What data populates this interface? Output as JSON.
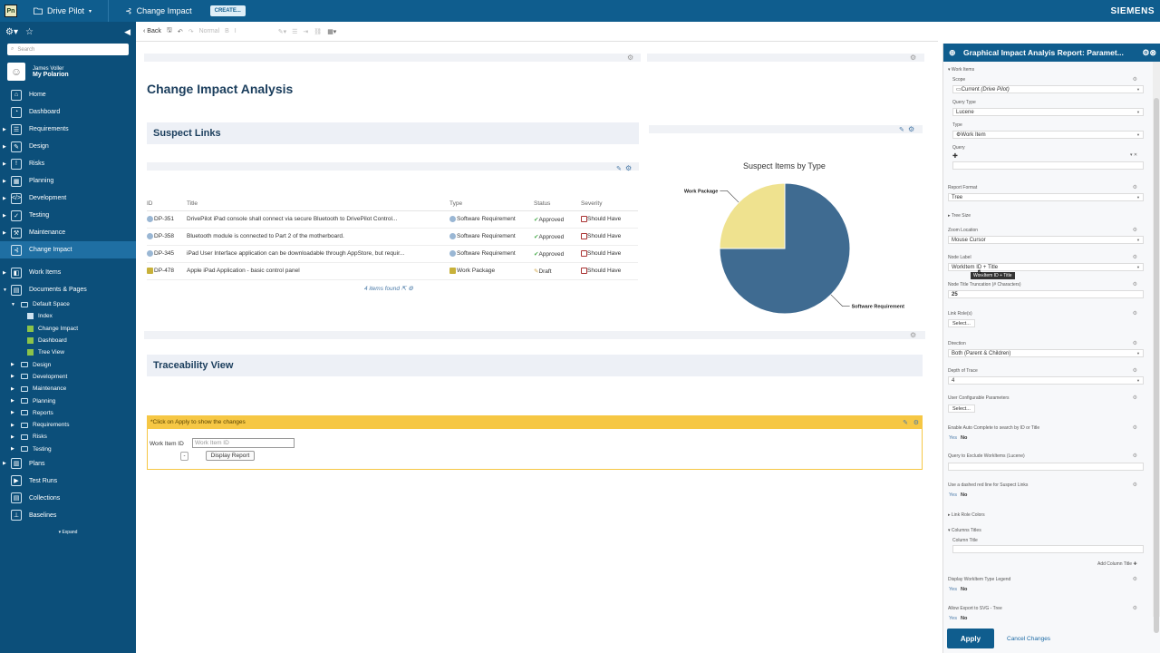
{
  "topbar": {
    "logo": "Pn",
    "project": "Drive Pilot",
    "page": "Change Impact",
    "create_label": "CREATE...",
    "brand": "SIEMENS"
  },
  "sidebar": {
    "search_placeholder": "Search",
    "user_name": "James Voller",
    "user_sub": "My Polarion",
    "nav": [
      {
        "label": "Home",
        "icon": "home-icon"
      },
      {
        "label": "Dashboard",
        "icon": "dashboard-icon"
      },
      {
        "label": "Requirements",
        "icon": "requirements-icon"
      },
      {
        "label": "Design",
        "icon": "design-icon"
      },
      {
        "label": "Risks",
        "icon": "risks-icon"
      },
      {
        "label": "Planning",
        "icon": "planning-icon"
      },
      {
        "label": "Development",
        "icon": "development-icon"
      },
      {
        "label": "Testing",
        "icon": "testing-icon"
      },
      {
        "label": "Maintenance",
        "icon": "maintenance-icon"
      },
      {
        "label": "Change Impact",
        "icon": "change-impact-icon"
      }
    ],
    "work_items": "Work Items",
    "docs_pages": "Documents & Pages",
    "tree": {
      "default_space": "Default Space",
      "default_children": [
        "Index",
        "Change Impact",
        "Dashboard",
        "Tree View"
      ],
      "spaces": [
        "Design",
        "Development",
        "Maintenance",
        "Planning",
        "Reports",
        "Requirements",
        "Risks",
        "Testing"
      ]
    },
    "bottom": [
      "Plans",
      "Test Runs",
      "Collections",
      "Baselines"
    ],
    "expand": "Expand"
  },
  "toolbar": {
    "back": "Back",
    "style": "Normal"
  },
  "main": {
    "title": "Change Impact Analysis",
    "suspect_header": "Suspect Links",
    "table_headers": [
      "ID",
      "Title",
      "Type",
      "Status",
      "Severity"
    ],
    "rows": [
      {
        "id": "DP-351",
        "title": "DrivePilot iPad console shall connect via secure Bluetooth to DrivePilot Control...",
        "type": "Software Requirement",
        "status": "Approved",
        "severity": "Should Have"
      },
      {
        "id": "DP-358",
        "title": "Bluetooth module is connected to Part 2 of the motherboard.",
        "type": "Software Requirement",
        "status": "Approved",
        "severity": "Should Have"
      },
      {
        "id": "DP-345",
        "title": "iPad User Interface application can be downloadable through AppStore, but requir...",
        "type": "Software Requirement",
        "status": "Approved",
        "severity": "Should Have"
      },
      {
        "id": "DP-478",
        "title": "Apple iPad Application - basic control panel",
        "type": "Work Package",
        "status": "Draft",
        "severity": "Should Have"
      }
    ],
    "items_found": "4 items found",
    "trace_header": "Traceability View",
    "trace_note": "*Click on Apply to show the changes",
    "wi_label": "Work Item ID",
    "wi_placeholder": "Work Item ID",
    "minus_label": "-",
    "display_label": "Display Report"
  },
  "chart_data": {
    "type": "pie",
    "title": "Suspect Items by Type",
    "categories": [
      "Software Requirement",
      "Work Package"
    ],
    "values": [
      3,
      1
    ],
    "colors": [
      "#3f6b91",
      "#efe28f"
    ]
  },
  "rpanel": {
    "title": "Graphical Impact Analyis Report: Paramet...",
    "work_items": "Work Items",
    "scope_label": "Scope",
    "scope_value": "Current",
    "scope_project": "(Drive Pilot)",
    "query_type_label": "Query Type",
    "query_type_value": "Lucene",
    "type_label": "Type",
    "type_value": "Work Item",
    "query_label": "Query",
    "report_format_label": "Report Format",
    "report_format_value": "Tree",
    "tree_size": "Tree Size",
    "zoom_label": "Zoom Location",
    "zoom_value": "Mouse Cursor",
    "node_label_label": "Node Label",
    "node_label_value": "WorkItem ID + Title",
    "tooltip": "WorkItem ID + Title",
    "truncation_label": "Node Title Truncation (# Characters)",
    "truncation_value": "25",
    "link_roles_label": "Link Role(s)",
    "select_label": "Select...",
    "direction_label": "Direction",
    "direction_value": "Both (Parent & Children)",
    "depth_label": "Depth of Trace",
    "depth_value": "4",
    "user_params_label": "User Configurable Parameters",
    "autocomplete_label": "Enable Auto Complete to search by ID or Title",
    "exclude_label": "Query to Exclude WorkItems (Lucene)",
    "dashed_label": "Use a dashed red line for Suspect Links",
    "link_colors": "Link Role Colors",
    "columns_titles": "Columns Titles",
    "column_title_label": "Column Title",
    "add_column": "Add Column Title",
    "legend_label": "Display WorkItem Type Legend",
    "export_label": "Allow Export to SVG - Tree",
    "yes": "Yes",
    "no": "No",
    "apply": "Apply",
    "cancel": "Cancel Changes"
  }
}
